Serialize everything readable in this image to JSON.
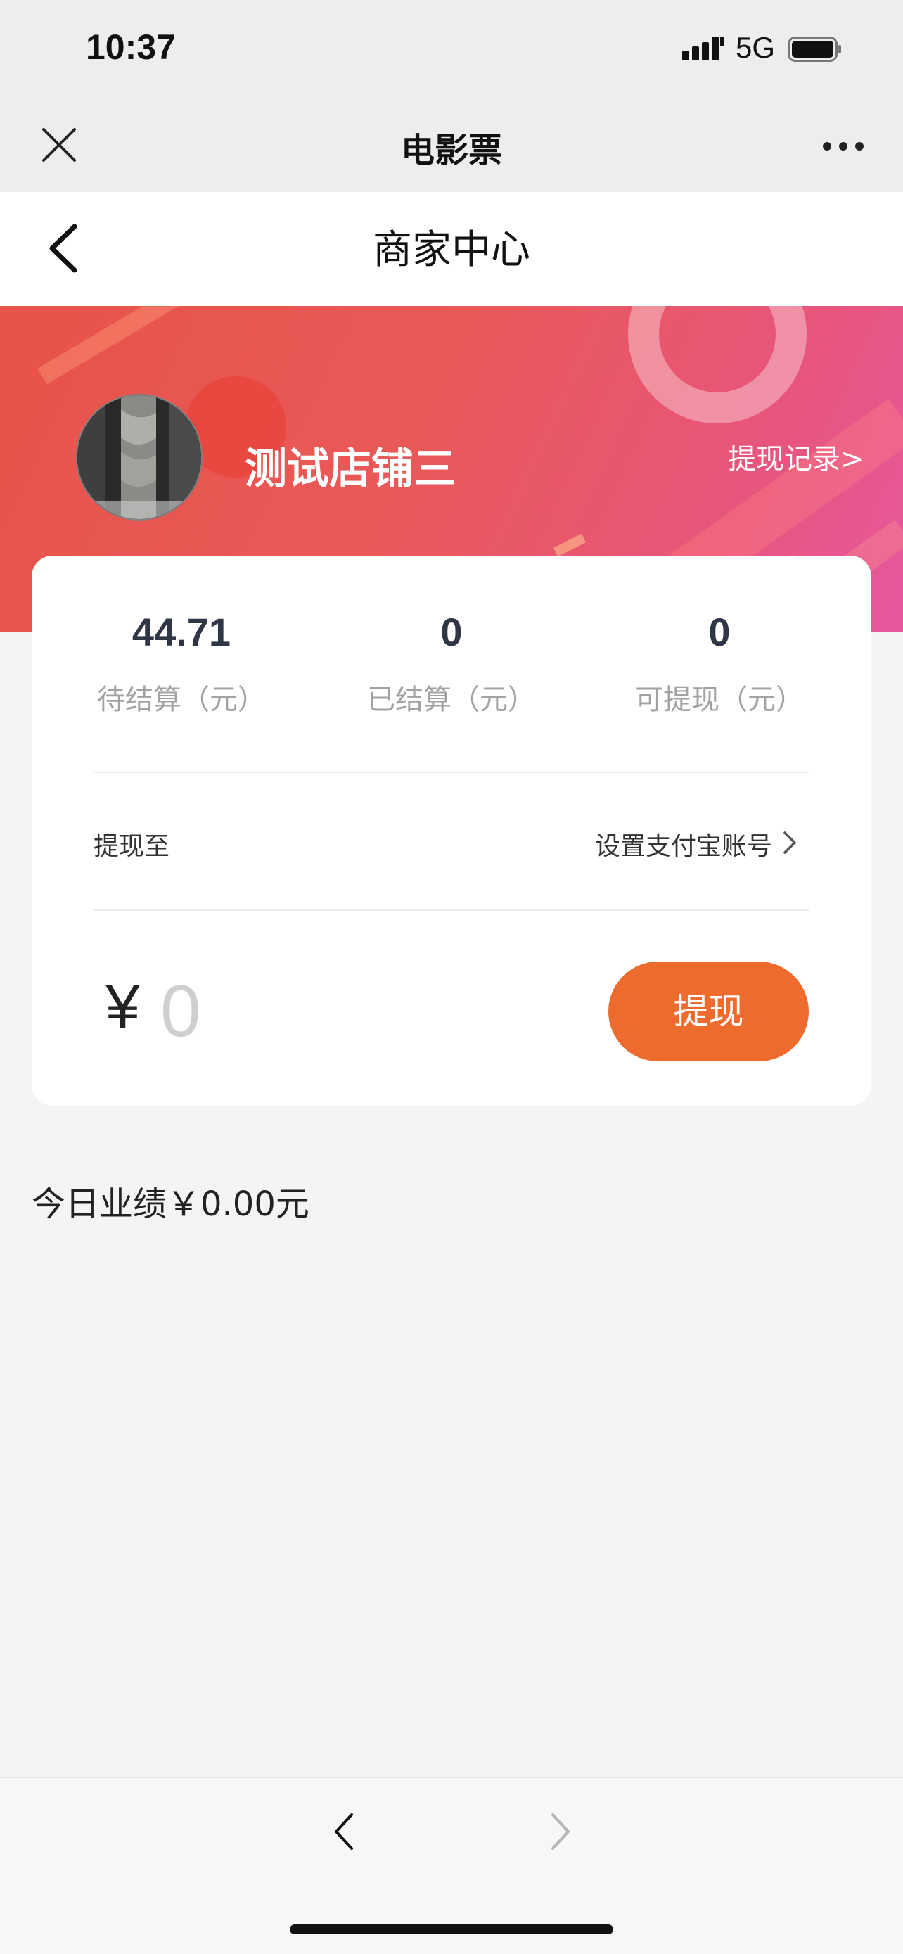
{
  "status_bar": {
    "time": "10:37",
    "network": "5G",
    "icons": [
      "signal-icon",
      "battery-icon"
    ]
  },
  "mini_program": {
    "title": "电影票",
    "icons": [
      "close-icon",
      "more-icon"
    ]
  },
  "header": {
    "title": "商家中心",
    "icons": [
      "back-icon"
    ]
  },
  "shop": {
    "name": "测试店铺三",
    "withdraw_record_label": "提现记录>"
  },
  "stats": [
    {
      "value": "44.71",
      "label": "待结算（元）"
    },
    {
      "value": "0",
      "label": "已结算（元）"
    },
    {
      "value": "0",
      "label": "可提现（元）"
    }
  ],
  "withdraw": {
    "to_label": "提现至",
    "account_link": "设置支付宝账号",
    "currency": "¥",
    "amount_placeholder": "0",
    "button_label": "提现"
  },
  "today_performance": "今日业绩￥0.00元",
  "colors": {
    "banner_start": "#e8534a",
    "banner_end": "#e6589f",
    "withdraw_button": "#ec6b2d",
    "stat_value": "#2f3645"
  },
  "bottom_bar": {
    "icons": [
      "nav-back-icon",
      "nav-forward-icon"
    ]
  }
}
